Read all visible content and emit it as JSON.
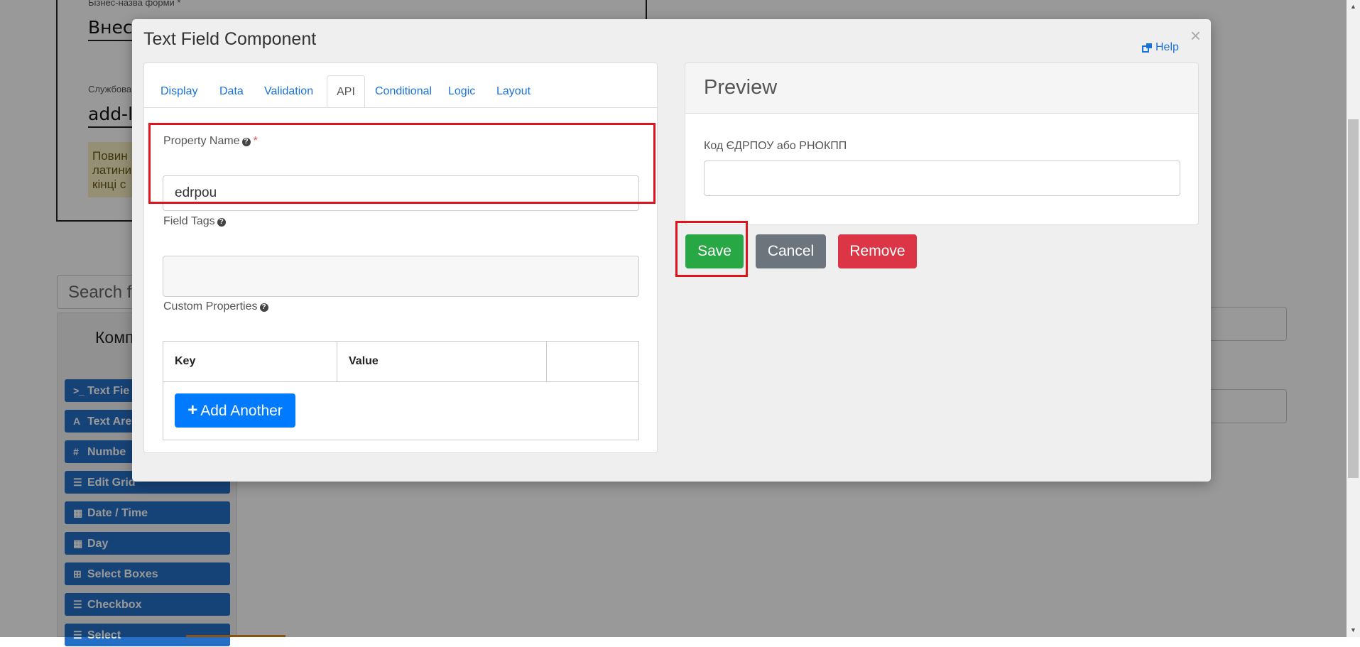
{
  "background": {
    "form_name_label": "Бізнес-назва форми *",
    "form_name_value": "Внесе",
    "service_name_label": "Службова",
    "service_name_value": "add-la",
    "note_text": "Повин\nлатини\nкінці с",
    "search_placeholder": "Search f",
    "sidebar_title": "Комп",
    "components": [
      {
        "icon": ">_",
        "label": "Text Fie"
      },
      {
        "icon": "A",
        "label": "Text Are"
      },
      {
        "icon": "#",
        "label": "Numbe"
      },
      {
        "icon": "☰",
        "label": "Edit Grid"
      },
      {
        "icon": "▦",
        "label": "Date / Time"
      },
      {
        "icon": "▦",
        "label": "Day"
      },
      {
        "icon": "⊞",
        "label": "Select Boxes"
      },
      {
        "icon": "☰",
        "label": "Checkbox"
      },
      {
        "icon": "☰",
        "label": "Select"
      }
    ]
  },
  "modal": {
    "title": "Text Field Component",
    "close_label": "×",
    "help_label": "Help",
    "tabs": [
      {
        "label": "Display",
        "active": false
      },
      {
        "label": "Data",
        "active": false
      },
      {
        "label": "Validation",
        "active": false
      },
      {
        "label": "API",
        "active": true
      },
      {
        "label": "Conditional",
        "active": false
      },
      {
        "label": "Logic",
        "active": false
      },
      {
        "label": "Layout",
        "active": false
      }
    ],
    "property_name": {
      "label": "Property Name",
      "required_mark": "*",
      "value": "edrpou"
    },
    "field_tags": {
      "label": "Field Tags",
      "value": ""
    },
    "custom_properties": {
      "label": "Custom Properties",
      "columns": [
        "Key",
        "Value",
        ""
      ],
      "add_button_label": "Add Another"
    },
    "preview": {
      "title": "Preview",
      "field_label": "Код ЄДРПОУ або РНОКПП",
      "field_value": ""
    },
    "buttons": {
      "save": "Save",
      "cancel": "Cancel",
      "remove": "Remove"
    }
  },
  "colors": {
    "primary": "#007bff",
    "success": "#28a745",
    "secondary": "#6c757d",
    "danger": "#dc3545",
    "highlight": "#e0121b"
  }
}
